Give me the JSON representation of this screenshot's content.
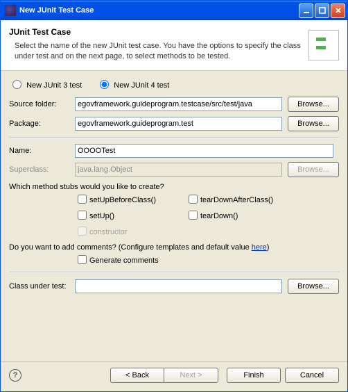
{
  "window": {
    "title": "New JUnit Test Case"
  },
  "banner": {
    "title": "JUnit Test Case",
    "desc": "Select the name of the new JUnit test case. You have the options to specify the class under test and on the next page, to select methods to be tested."
  },
  "radios": {
    "junit3": "New JUnit 3 test",
    "junit4": "New JUnit 4 test",
    "selected": "junit4"
  },
  "labels": {
    "sourceFolder": "Source folder:",
    "package": "Package:",
    "name": "Name:",
    "superclass": "Superclass:",
    "classUnderTest": "Class under test:"
  },
  "values": {
    "sourceFolder": "egovframework.guideprogram.testcase/src/test/java",
    "package": "egovframework.guideprogram.test",
    "name": "OOOOTest",
    "superclass": "java.lang.Object",
    "classUnderTest": ""
  },
  "stubs": {
    "question": "Which method stubs would you like to create?",
    "setUpBeforeClass": "setUpBeforeClass()",
    "tearDownAfterClass": "tearDownAfterClass()",
    "setUp": "setUp()",
    "tearDown": "tearDown()",
    "constructor": "constructor"
  },
  "comments": {
    "question_prefix": "Do you want to add comments? (Configure templates and default value ",
    "link": "here",
    "question_suffix": ")",
    "generate": "Generate comments"
  },
  "buttons": {
    "browse": "Browse...",
    "back": "< Back",
    "next": "Next >",
    "finish": "Finish",
    "cancel": "Cancel"
  }
}
